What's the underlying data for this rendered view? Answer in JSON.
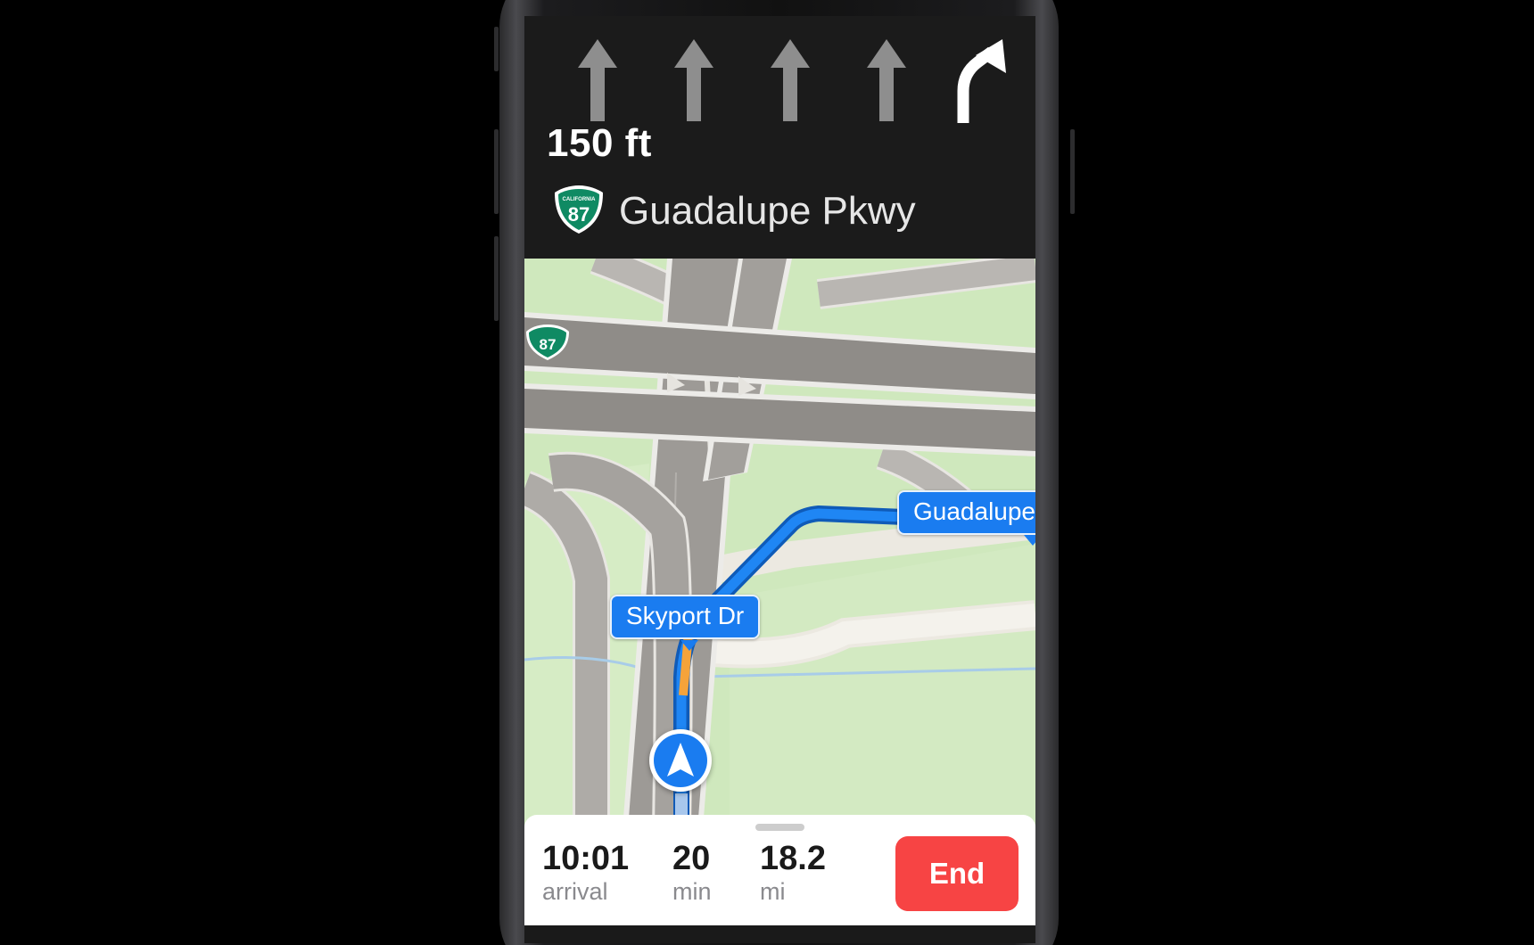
{
  "banner": {
    "distance": "150 ft",
    "street": "Guadalupe Pkwy",
    "shield": {
      "state_text": "CALIFORNIA",
      "route_number": "87",
      "color": "#0f8a63"
    },
    "lanes": [
      {
        "icon": "straight-arrow-icon",
        "active": false
      },
      {
        "icon": "straight-arrow-icon",
        "active": false
      },
      {
        "icon": "straight-arrow-icon",
        "active": false
      },
      {
        "icon": "straight-arrow-icon",
        "active": false
      },
      {
        "icon": "bear-right-arrow-icon",
        "active": true
      }
    ]
  },
  "map": {
    "highway_shield_number": "87",
    "callouts": {
      "next_street": "Guadalupe",
      "current_street": "Skyport Dr"
    },
    "route_color": "#1a7cf0",
    "traffic_color": "#f5a33a"
  },
  "tray": {
    "arrival": {
      "value": "10:01",
      "label": "arrival"
    },
    "duration": {
      "value": "20",
      "label": "min"
    },
    "distance": {
      "value": "18.2",
      "label": "mi"
    },
    "end_label": "End"
  }
}
